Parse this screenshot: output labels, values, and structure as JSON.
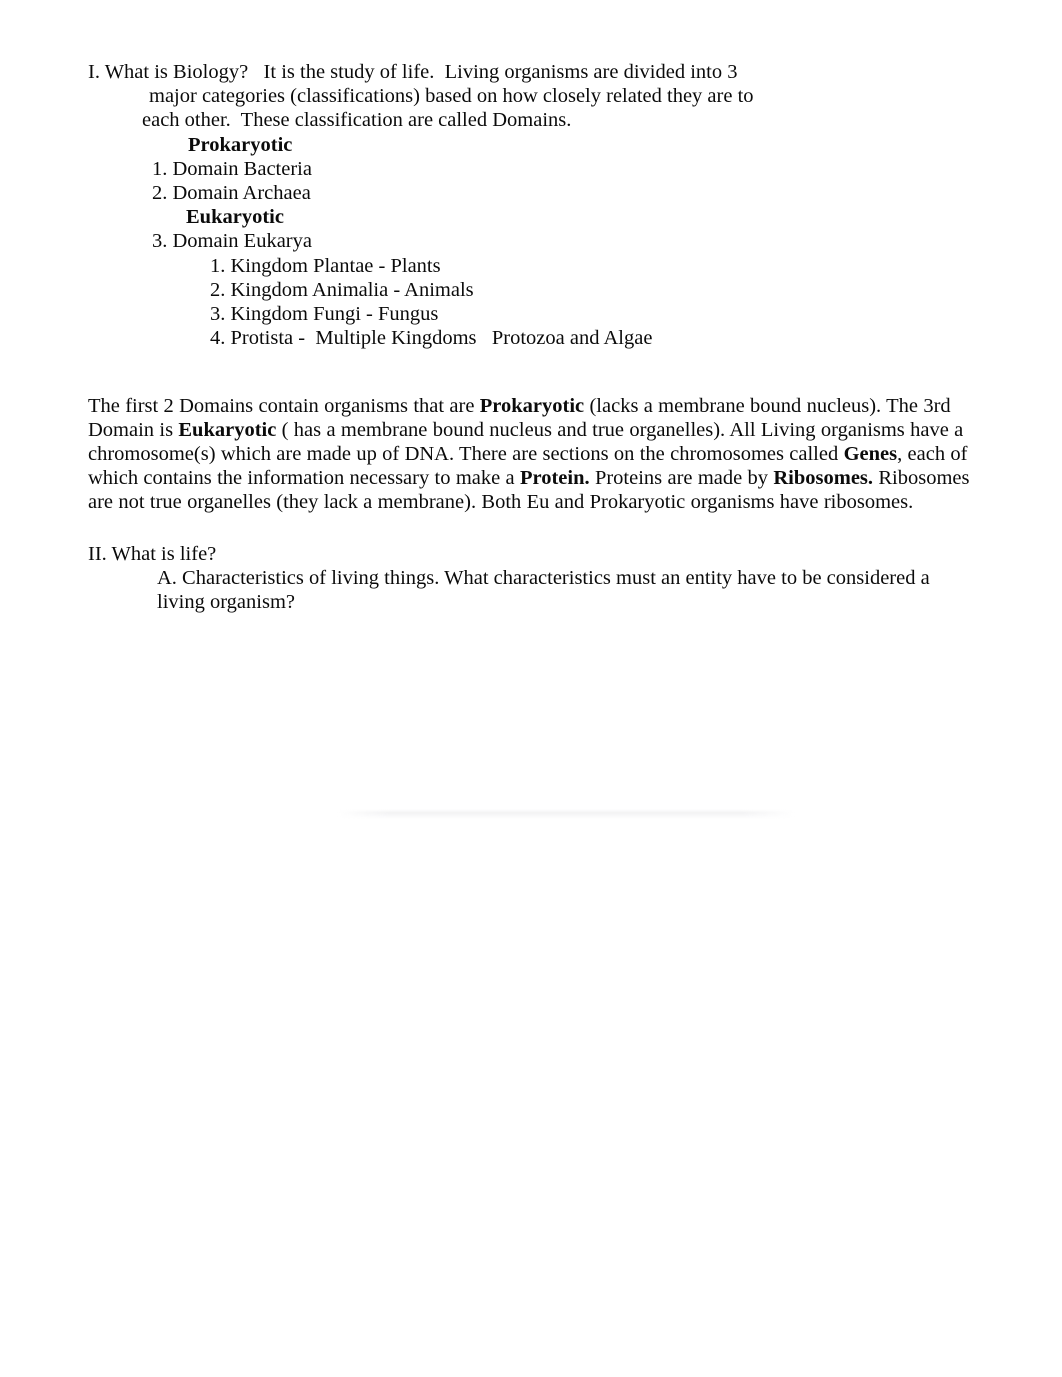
{
  "document": {
    "background_color": "#ffffff",
    "text_color": "#0b0b0b"
  },
  "section_one": {
    "line1": "I. What is Biology?   It is the study of life.  Living organisms are divided into 3",
    "line2": "major categories (classifications) based on how closely related they are to",
    "line3": "each other.  These classification are called Domains.",
    "prokaryotic_heading": "Prokaryotic",
    "item1": "1. Domain Bacteria",
    "item2": "2. Domain Archaea",
    "eukaryotic_heading": "Eukaryotic",
    "item3": "3. Domain Eukarya",
    "sub1": "1. Kingdom Plantae - Plants",
    "sub2": "2. Kingdom Animalia - Animals",
    "sub3": "3. Kingdom Fungi - Fungus",
    "sub4": "4. Protista -  Multiple Kingdoms   Protozoa and Algae"
  },
  "paragraph": {
    "part1": "The first 2 Domains contain organisms that are ",
    "bold1": "Prokaryotic",
    "part2": " (lacks a membrane bound nucleus).  The 3rd Domain is ",
    "bold2": "Eukaryotic",
    "part3": " ( has a membrane bound nucleus and true organelles).  All Living organisms have a chromosome(s) which are made up of DNA.  There are sections on the chromosomes called ",
    "bold3": "Genes",
    "part4": ", each of which contains the information necessary to make a ",
    "bold4": "Protein.",
    "part5": " Proteins are made by ",
    "bold5": "Ribosomes.",
    "part6": " Ribosomes are not true organelles (they lack a membrane).  Both Eu and Prokaryotic organisms have ribosomes."
  },
  "section_two": {
    "heading": "II. What is life?",
    "item_a": "A. Characteristics of living things.  What characteristics must an entity have to be considered a living organism?"
  }
}
